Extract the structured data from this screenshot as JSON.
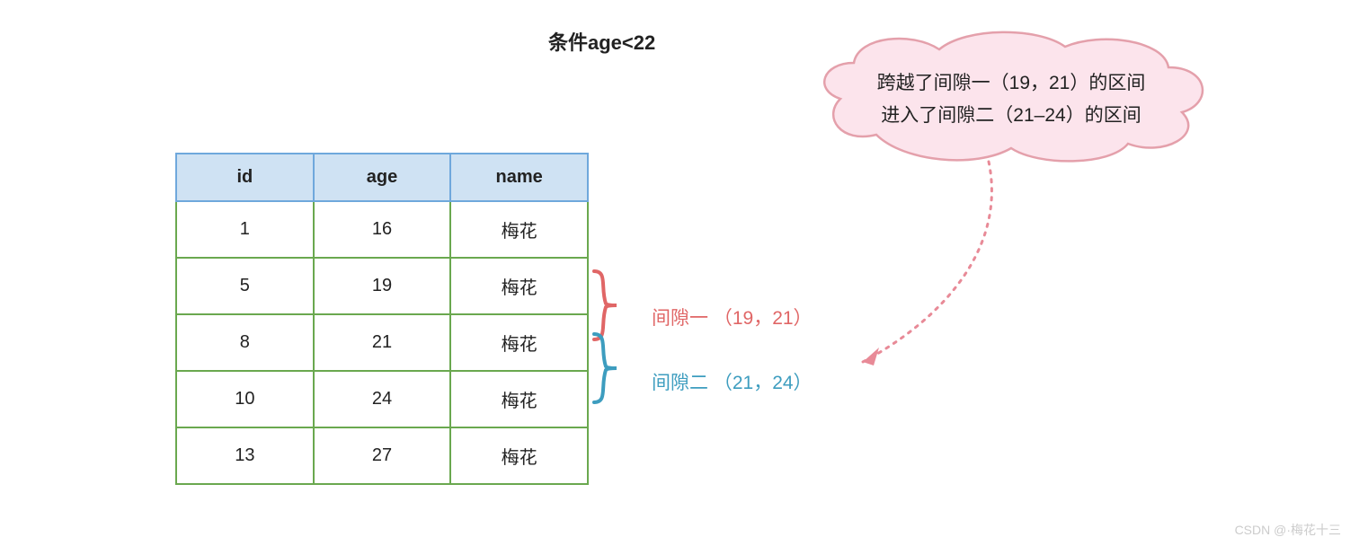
{
  "title": "条件age<22",
  "table": {
    "headers": [
      "id",
      "age",
      "name"
    ],
    "rows": [
      {
        "id": "1",
        "age": "16",
        "name": "梅花"
      },
      {
        "id": "5",
        "age": "19",
        "name": "梅花"
      },
      {
        "id": "8",
        "age": "21",
        "name": "梅花"
      },
      {
        "id": "10",
        "age": "24",
        "name": "梅花"
      },
      {
        "id": "13",
        "age": "27",
        "name": "梅花"
      }
    ]
  },
  "gap1": {
    "label": "间隙一 （19，21）"
  },
  "gap2": {
    "label": "间隙二 （21，24）"
  },
  "cloud": {
    "line1": "跨越了间隙一（19，21）的区间",
    "line2": "进入了间隙二（21–24）的区间"
  },
  "colors": {
    "headerBg": "#cfe2f3",
    "headerBorder": "#6fa8dc",
    "cellBorder": "#6aa84f",
    "gap1Color": "#e06666",
    "gap2Color": "#3d9dbf",
    "cloudFill": "#fce4ec",
    "cloudStroke": "#e06666"
  },
  "watermark": "CSDN @·梅花十三"
}
